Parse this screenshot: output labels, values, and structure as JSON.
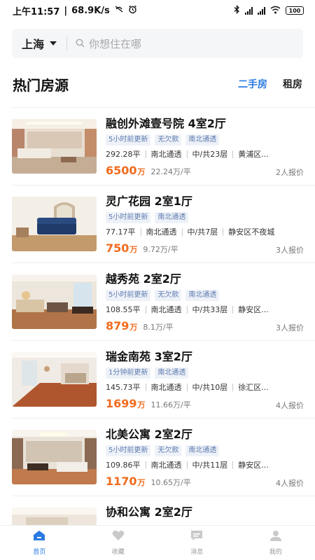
{
  "status_bar": {
    "time": "上午11:57",
    "separator": "|",
    "net_speed": "68.9K/s",
    "battery": "100"
  },
  "search": {
    "city": "上海",
    "placeholder": "你想住在哪"
  },
  "section": {
    "title": "热门房源",
    "tabs": [
      {
        "label": "二手房",
        "active": true
      },
      {
        "label": "租房",
        "active": false
      }
    ]
  },
  "listings": [
    {
      "title": "融创外滩壹号院 4室2厅",
      "tags": [
        "5小时前更新",
        "无欠款",
        "南北通透"
      ],
      "area": "292.28平",
      "orientation": "南北通透",
      "floor": "中/共23层",
      "district": "黄浦区...",
      "price": "6500",
      "price_unit": "万",
      "unit_price": "22.24万/平",
      "quotes": "2人报价"
    },
    {
      "title": "灵广花园 2室1厅",
      "tags": [
        "5小时前更新",
        "南北通透"
      ],
      "area": "77.17平",
      "orientation": "南北通透",
      "floor": "中/共7层",
      "district": "静安区不夜城",
      "price": "750",
      "price_unit": "万",
      "unit_price": "9.72万/平",
      "quotes": "3人报价"
    },
    {
      "title": "越秀苑 2室2厅",
      "tags": [
        "5小时前更新",
        "无欠款",
        "南北通透"
      ],
      "area": "108.55平",
      "orientation": "南北通透",
      "floor": "中/共33层",
      "district": "静安区...",
      "price": "879",
      "price_unit": "万",
      "unit_price": "8.1万/平",
      "quotes": "3人报价"
    },
    {
      "title": "瑞金南苑 3室2厅",
      "tags": [
        "1分钟前更新",
        "南北通透"
      ],
      "area": "145.73平",
      "orientation": "南北通透",
      "floor": "中/共10层",
      "district": "徐汇区...",
      "price": "1699",
      "price_unit": "万",
      "unit_price": "11.66万/平",
      "quotes": "4人报价"
    },
    {
      "title": "北美公寓 2室2厅",
      "tags": [
        "5小时前更新",
        "无欠款",
        "南北通透"
      ],
      "area": "109.86平",
      "orientation": "南北通透",
      "floor": "中/共11层",
      "district": "静安区...",
      "price": "1170",
      "price_unit": "万",
      "unit_price": "10.65万/平",
      "quotes": "4人报价"
    },
    {
      "title": "协和公寓 2室2厅",
      "tags": [],
      "area": "",
      "orientation": "",
      "floor": "",
      "district": "",
      "price": "",
      "price_unit": "",
      "unit_price": "",
      "quotes": ""
    }
  ],
  "tabbar": [
    {
      "label": "首页",
      "icon": "home-icon",
      "active": true
    },
    {
      "label": "收藏",
      "icon": "heart-icon",
      "active": false
    },
    {
      "label": "消息",
      "icon": "message-icon",
      "active": false
    },
    {
      "label": "我的",
      "icon": "user-icon",
      "active": false
    }
  ],
  "colors": {
    "accent": "#2a7ae2",
    "price": "#f06b1e",
    "tag_text": "#5e7bb0",
    "tag_bg": "#eef2f8",
    "search_bg": "#f5f6f8"
  }
}
